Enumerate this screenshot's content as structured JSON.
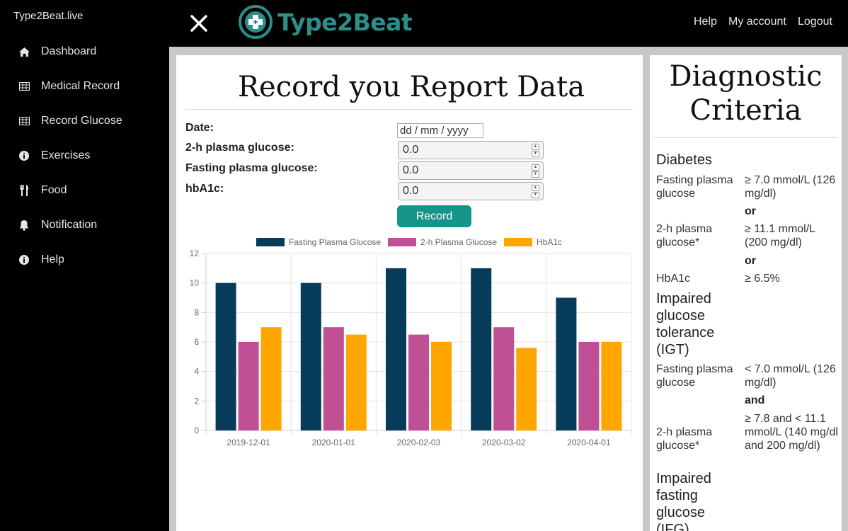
{
  "sidebar": {
    "brand": "Type2Beat.live",
    "items": [
      {
        "label": "Dashboard",
        "icon": "home-icon"
      },
      {
        "label": "Medical Record",
        "icon": "table-icon"
      },
      {
        "label": "Record Glucose",
        "icon": "table-icon"
      },
      {
        "label": "Exercises",
        "icon": "info-icon"
      },
      {
        "label": "Food",
        "icon": "cutlery-icon"
      },
      {
        "label": "Notification",
        "icon": "bell-icon"
      },
      {
        "label": "Help",
        "icon": "info-icon"
      }
    ]
  },
  "header": {
    "logo_text": "Type2Beat",
    "links": {
      "help": "Help",
      "account": "My account",
      "logout": "Logout"
    }
  },
  "form": {
    "title": "Record you Report Data",
    "date_label": "Date:",
    "date_value": "dd / mm / yyyy",
    "two_h_label": "2-h plasma glucose:",
    "two_h_value": "0.0",
    "fasting_label": "Fasting plasma glucose:",
    "fasting_value": "0.0",
    "hba1c_label": "hbA1c:",
    "hba1c_value": "0.0",
    "record_button": "Record"
  },
  "chart_data": {
    "type": "bar",
    "categories": [
      "2019-12-01",
      "2020-01-01",
      "2020-02-03",
      "2020-03-02",
      "2020-04-01"
    ],
    "series": [
      {
        "name": "Fasting Plasma Glucose",
        "color": "#073b5a",
        "values": [
          10,
          10,
          11,
          11,
          9
        ]
      },
      {
        "name": "2-h Plasma Glucose",
        "color": "#bf5096",
        "values": [
          6,
          7,
          6.5,
          7,
          6
        ]
      },
      {
        "name": "HbA1c",
        "color": "#ffa600",
        "values": [
          7,
          6.5,
          6,
          5.6,
          6
        ]
      }
    ],
    "ylim": [
      0,
      12
    ],
    "yticks": [
      0,
      2,
      4,
      6,
      8,
      10,
      12
    ],
    "grid": true,
    "legend": "top"
  },
  "diagnostic": {
    "title_line1": "Diagnostic",
    "title_line2": "Criteria",
    "diabetes": {
      "heading": "Diabetes",
      "fpg_label": "Fasting plasma glucose",
      "fpg_value": "≥ 7.0 mmol/L (126 mg/dl)",
      "or1": "or",
      "two_h_label": "2-h plasma glucose*",
      "two_h_value": "≥ 11.1 mmol/L (200 mg/dl)",
      "or2": "or",
      "hba1c_label": "HbA1c",
      "hba1c_value": "≥ 6.5%"
    },
    "igt": {
      "heading": "Impaired glucose tolerance (IGT)",
      "fpg_label": "Fasting plasma glucose",
      "fpg_value": "< 7.0 mmol/L (126 mg/dl)",
      "and": "and",
      "two_h_label": "2-h plasma glucose*",
      "two_h_value": "≥ 7.8 and < 11.1 mmol/L (140 mg/dl and 200 mg/dl)"
    },
    "ifg": {
      "heading": "Impaired fasting glucose (IFG)"
    }
  }
}
